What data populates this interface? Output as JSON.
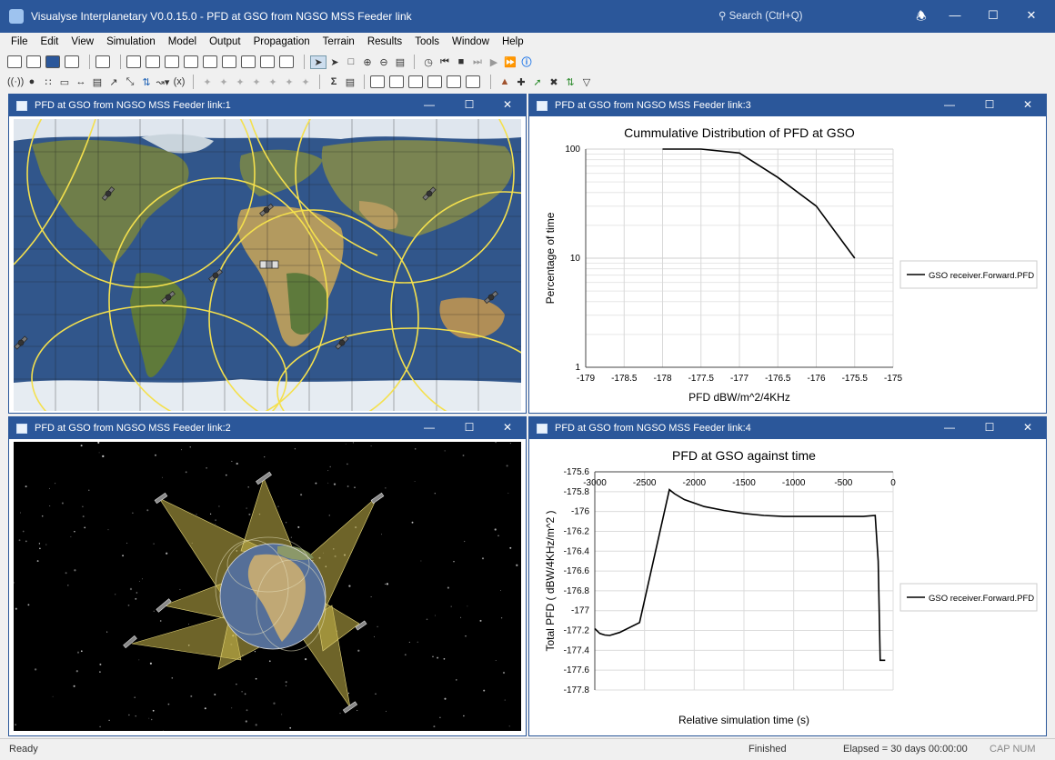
{
  "app": {
    "title": "Visualyse Interplanetary V0.0.15.0 - PFD at GSO from NGSO MSS Feeder link",
    "search_placeholder": "Search (Ctrl+Q)"
  },
  "menu": [
    "File",
    "Edit",
    "View",
    "Simulation",
    "Model",
    "Output",
    "Propagation",
    "Terrain",
    "Results",
    "Tools",
    "Window",
    "Help"
  ],
  "windows": {
    "w1": {
      "title": "PFD at GSO from NGSO MSS Feeder link:1"
    },
    "w2": {
      "title": "PFD at GSO from NGSO MSS Feeder link:2"
    },
    "w3": {
      "title": "PFD at GSO from NGSO MSS Feeder link:3"
    },
    "w4": {
      "title": "PFD at GSO from NGSO MSS Feeder link:4"
    }
  },
  "chart_data": [
    {
      "type": "line",
      "title": "Cummulative Distribution of PFD at GSO",
      "xlabel": "PFD dBW/m^2/4KHz",
      "ylabel": "Percentage of time",
      "xlim": [
        -179,
        -175
      ],
      "ylim": [
        1,
        100
      ],
      "yscale": "log",
      "xticks": [
        "-179",
        "-178.5",
        "-178",
        "-177.5",
        "-177",
        "-176.5",
        "-176",
        "-175.5",
        "-175"
      ],
      "yticks": [
        "100",
        "10",
        "1"
      ],
      "legend_position": "right",
      "grid": true,
      "series": [
        {
          "name": "GSO receiver.Forward.PFD",
          "x": [
            -178,
            -177.5,
            -177,
            -176.5,
            -176,
            -175.5
          ],
          "y": [
            100,
            100,
            92,
            55,
            30,
            10
          ]
        }
      ]
    },
    {
      "type": "line",
      "title": "PFD at GSO against time",
      "xlabel": "Relative simulation time (s)",
      "ylabel": "Total PFD ( dBW/4KHz/m^2 )",
      "xlim": [
        -3000,
        0
      ],
      "ylim": [
        -177.8,
        -175.6
      ],
      "xaxis_position": "top",
      "xticks": [
        "-3000",
        "-2500",
        "-2000",
        "-1500",
        "-1000",
        "-500",
        "0"
      ],
      "yticks": [
        "-175.6",
        "-175.8",
        "-176",
        "-176.2",
        "-176.4",
        "-176.6",
        "-176.8",
        "-177",
        "-177.2",
        "-177.4",
        "-177.6",
        "-177.8"
      ],
      "legend_position": "right",
      "grid": true,
      "series": [
        {
          "name": "GSO receiver.Forward.PFD",
          "x": [
            -3000,
            -2950,
            -2900,
            -2850,
            -2750,
            -2550,
            -2250,
            -2200,
            -2100,
            -1900,
            -1700,
            -1500,
            -1300,
            -1100,
            -900,
            -700,
            -500,
            -300,
            -180,
            -150,
            -130,
            -100,
            -80
          ],
          "y": [
            -177.18,
            -177.23,
            -177.245,
            -177.25,
            -177.22,
            -177.12,
            -175.78,
            -175.82,
            -175.88,
            -175.95,
            -175.99,
            -176.02,
            -176.04,
            -176.05,
            -176.05,
            -176.05,
            -176.05,
            -176.05,
            -176.04,
            -176.5,
            -177.5,
            -177.5,
            -177.5
          ]
        }
      ]
    }
  ],
  "status": {
    "left": "Ready",
    "state": "Finished",
    "elapsed": "Elapsed = 30 days 00:00:00",
    "keys": "CAP NUM"
  },
  "colors": {
    "accent": "#2b579a",
    "coverage": "#f4e04d",
    "beam_fill": "#c9b74a"
  }
}
